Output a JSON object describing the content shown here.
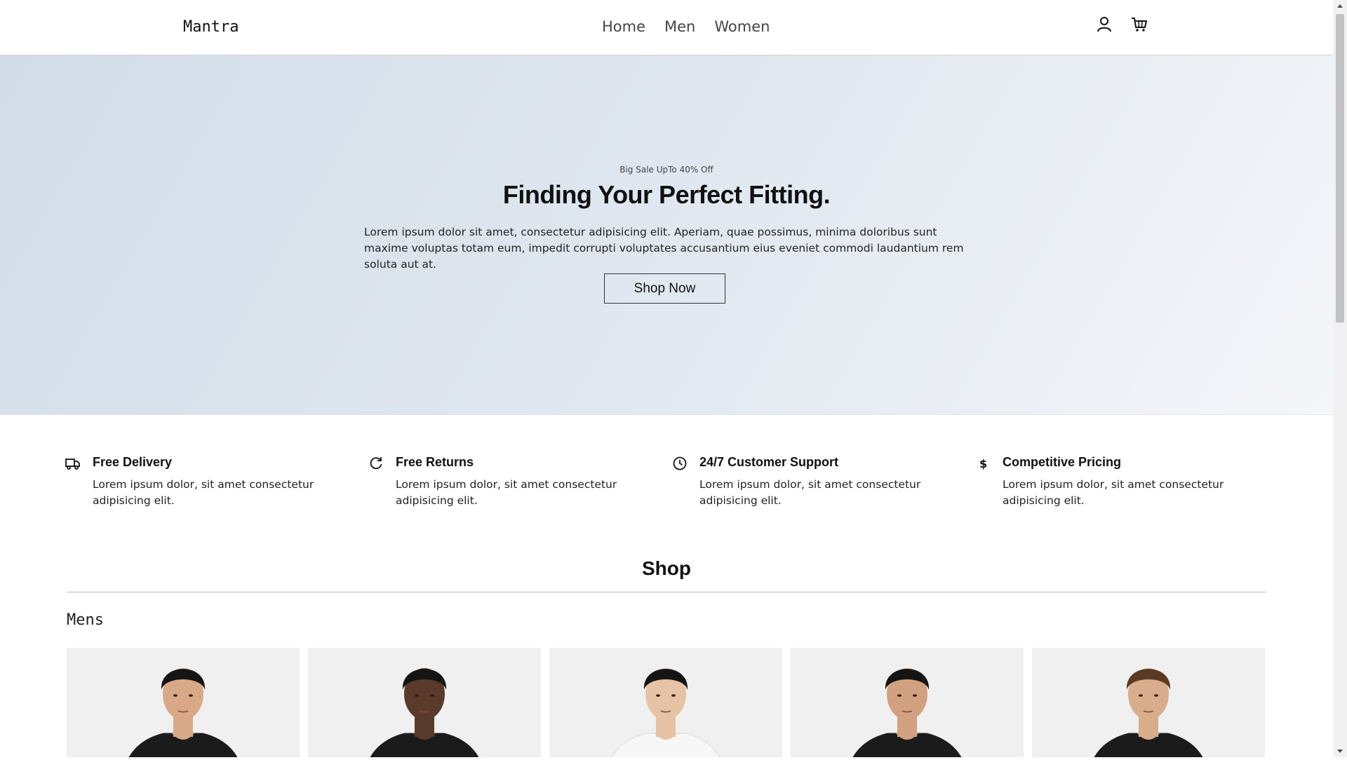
{
  "header": {
    "brand": "Mantra",
    "nav": [
      "Home",
      "Men",
      "Women"
    ],
    "icons": [
      "user-icon",
      "cart-icon"
    ]
  },
  "hero": {
    "subtitle": "Big Sale UpTo 40% Off",
    "title": "Finding Your Perfect Fitting.",
    "text": "Lorem ipsum dolor sit amet, consectetur adipisicing elit. Aperiam, quae possimus, minima doloribus sunt maxime voluptas totam eum, impedit corrupti voluptates accusantium eius eveniet commodi laudantium rem soluta aut at.",
    "button": "Shop Now"
  },
  "features": [
    {
      "icon": "truck-icon",
      "title": "Free Delivery",
      "text": "Lorem ipsum dolor, sit amet consectetur adipisicing elit."
    },
    {
      "icon": "refresh-icon",
      "title": "Free Returns",
      "text": "Lorem ipsum dolor, sit amet consectetur adipisicing elit."
    },
    {
      "icon": "clock-icon",
      "title": "24/7 Customer Support",
      "text": "Lorem ipsum dolor, sit amet consectetur adipisicing elit."
    },
    {
      "icon": "dollar-icon",
      "title": "Competitive Pricing",
      "text": "Lorem ipsum dolor, sit amet consectetur adipisicing elit."
    }
  ],
  "shop": {
    "heading": "Shop",
    "section": "Mens",
    "products": [
      {
        "shirt": "black",
        "skin": "#d9a987",
        "hair": "#151515"
      },
      {
        "shirt": "black",
        "skin": "#5a3a2a",
        "hair": "#151515"
      },
      {
        "shirt": "white",
        "skin": "#e6c3a5",
        "hair": "#151515"
      },
      {
        "shirt": "black",
        "skin": "#d2a17f",
        "hair": "#151515"
      },
      {
        "shirt": "black",
        "skin": "#d9ad8c",
        "hair": "#5a3a22"
      }
    ]
  },
  "colors": {
    "hero_gradient_start": "#d2dce8",
    "hero_gradient_end": "#f4f6f9",
    "product_card_bg": "#f0f0f0"
  }
}
